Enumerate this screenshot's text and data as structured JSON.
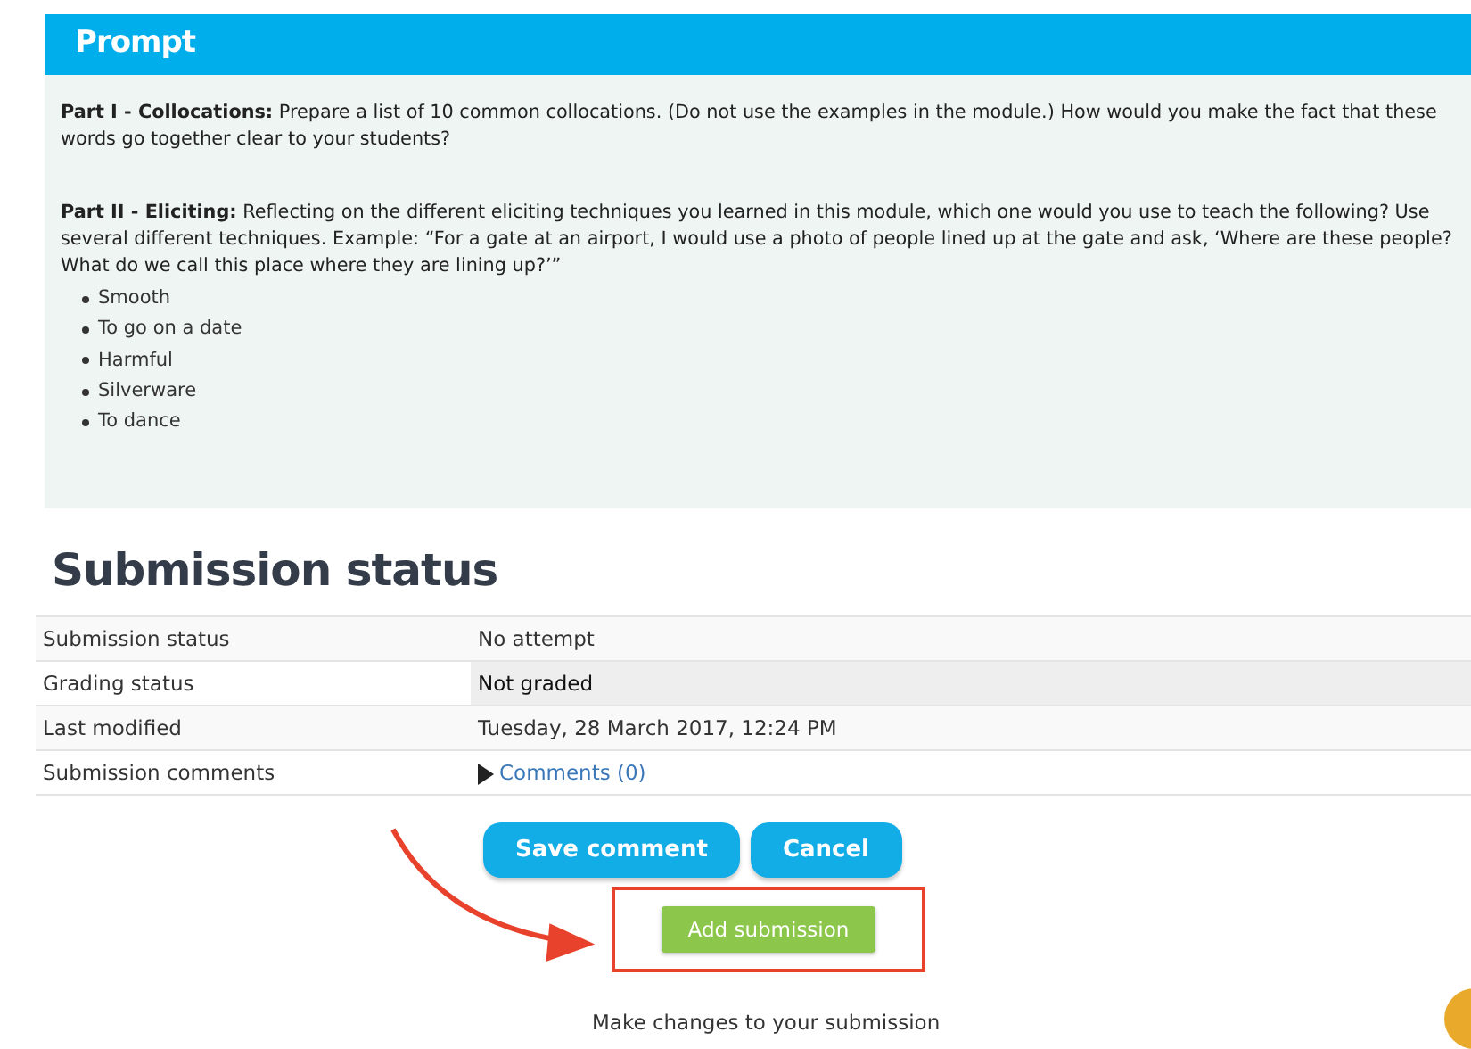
{
  "prompt": {
    "title": "Prompt",
    "paragraphs": [
      "**Part I - Collocations:**  Prepare a list of 10 common collocations. (Do not use the examples in the module.) How would you make the fact that these words go together clear to your students?",
      "**Part II - Eliciting:**  Reflecting on the different eliciting techniques you learned in this module, which one would you use to teach the following? Use several different techniques. Example: “For a gate at an airport, I would use a photo of people lined up at the gate and ask, ‘Where are these people? What do we call this place where they are lining up?’”"
    ],
    "items": [
      "Smooth",
      "To go on a date",
      "Harmful",
      "Silverware",
      "To dance"
    ]
  },
  "submission": {
    "heading": "Submission status",
    "rows": [
      {
        "label": "Submission status",
        "value": "No attempt",
        "kind": "text",
        "shaded": false
      },
      {
        "label": "Grading status",
        "value": "Not graded",
        "kind": "text",
        "shaded": true
      },
      {
        "label": "Last modified",
        "value": "Tuesday, 28 March 2017, 12:24 PM",
        "kind": "text",
        "shaded": false
      },
      {
        "label": "Submission comments",
        "value": "Comments (0)",
        "kind": "link",
        "shaded": false
      }
    ],
    "comment_buttons": [
      "Save comment",
      "Cancel"
    ],
    "add_button": "Add submission",
    "hint": "Make changes to your submission"
  }
}
